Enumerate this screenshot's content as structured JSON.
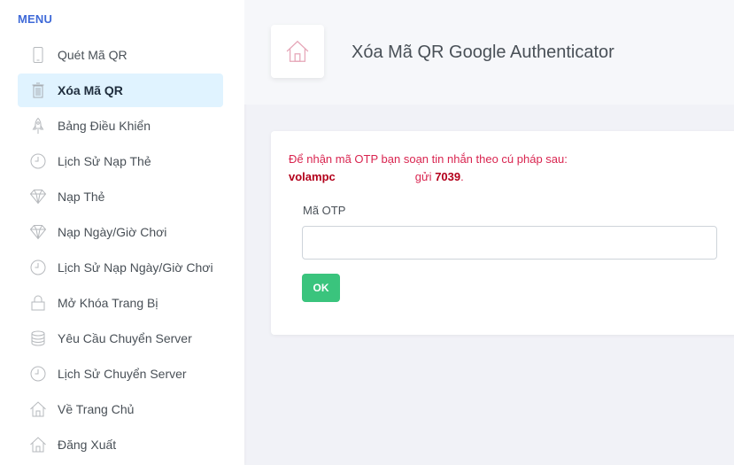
{
  "sidebar": {
    "menu_title": "MENU",
    "items": [
      {
        "label": "Quét Mã QR",
        "icon": "phone-icon"
      },
      {
        "label": "Xóa Mã QR",
        "icon": "trash-icon",
        "active": true
      },
      {
        "label": "Bảng Điều Khiển",
        "icon": "rocket-icon"
      },
      {
        "label": "Lịch Sử Nạp Thẻ",
        "icon": "clock-icon"
      },
      {
        "label": "Nạp Thẻ",
        "icon": "diamond-icon"
      },
      {
        "label": "Nạp Ngày/Giờ Chơi",
        "icon": "diamond-icon"
      },
      {
        "label": "Lịch Sử Nạp Ngày/Giờ Chơi",
        "icon": "clock-icon"
      },
      {
        "label": "Mở Khóa Trang Bị",
        "icon": "lock-icon"
      },
      {
        "label": "Yêu Cầu Chuyển Server",
        "icon": "database-icon"
      },
      {
        "label": "Lịch Sử Chuyển Server",
        "icon": "clock-icon"
      },
      {
        "label": "Về Trang Chủ",
        "icon": "home-icon"
      },
      {
        "label": "Đăng Xuất",
        "icon": "home-icon"
      }
    ]
  },
  "header": {
    "title": "Xóa Mã QR Google Authenticator",
    "icon": "home-icon"
  },
  "form": {
    "instruction": "Để nhận mã OTP bạn soạn tin nhắn theo cú pháp sau:",
    "sms_keyword": "volampc",
    "send_word": "gửi",
    "sms_number": "7039",
    "end_punct": ".",
    "otp_label": "Mã OTP",
    "otp_value": "",
    "ok_label": "OK"
  },
  "colors": {
    "accent": "#3f6ad8",
    "active_bg": "#e0f3ff",
    "alert_text": "#d92550",
    "ok_button": "#3ac47d"
  }
}
